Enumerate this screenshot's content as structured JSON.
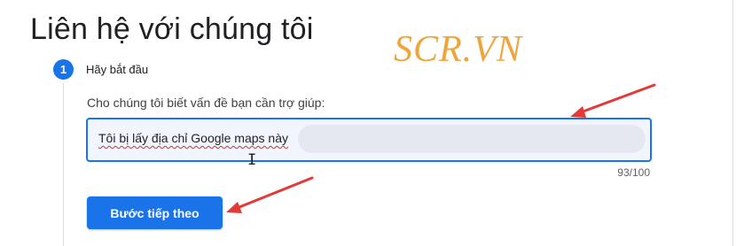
{
  "header": {
    "title": "Liên hệ với chúng tôi",
    "watermark": "SCR.VN"
  },
  "step": {
    "number": "1",
    "title": "Hãy bắt đầu"
  },
  "form": {
    "field_label": "Cho chúng tôi biết vấn đề bạn cần trợ giúp:",
    "input_value": "Tôi bị lấy địa chỉ Google maps này",
    "char_count": "93/100",
    "next_button_label": "Bước tiếp theo"
  },
  "colors": {
    "accent": "#1a73e8",
    "annotation_arrow": "#e53935",
    "watermark": "#f0a53a"
  },
  "icons": {
    "text_cursor": "text-cursor-icon"
  }
}
